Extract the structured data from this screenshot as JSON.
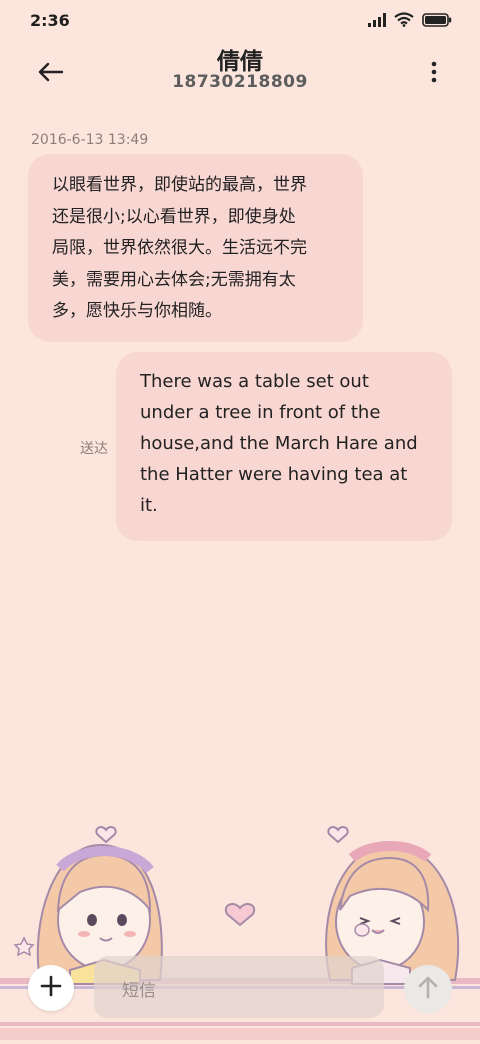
{
  "status_bar": {
    "time": "2:36",
    "icons": [
      "signal-icon",
      "wifi-icon",
      "battery-icon"
    ]
  },
  "header": {
    "contact_name": "倩倩",
    "contact_number": "18730218809",
    "back_icon": "back-arrow-icon",
    "more_icon": "more-vertical-icon"
  },
  "conversation": {
    "timestamp": "2016-6-13 13:49",
    "messages": [
      {
        "direction": "incoming",
        "text": "以眼看世界，即使站的最高，世界\n还是很小;以心看世界，即使身处\n局限，世界依然很大。生活远不完\n美，需要用心去体会;无需拥有太\n多，愿快乐与你相随。"
      },
      {
        "direction": "outgoing",
        "text": "There was a table set out\nunder a tree in front of the\nhouse,and the March Hare and\nthe Hatter were having tea at\nit.",
        "status": "送达"
      }
    ]
  },
  "composer": {
    "placeholder": "短信",
    "add_icon": "plus-icon",
    "send_icon": "send-arrow-icon"
  },
  "colors": {
    "background": "#fbe5dc",
    "bubble": "#f8d6d2",
    "input": "#e1d2cd"
  }
}
